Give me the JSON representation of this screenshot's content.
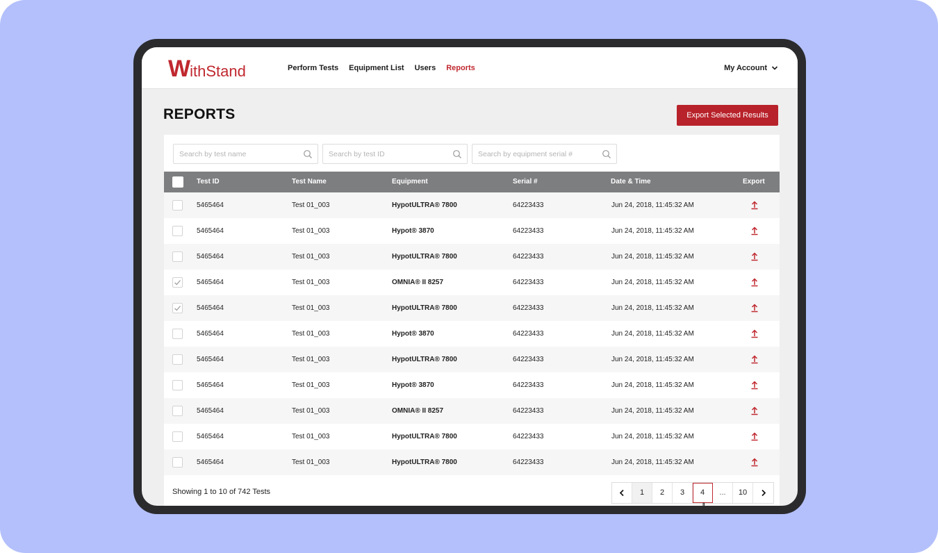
{
  "brand": {
    "logo_initial": "W",
    "logo_rest": "ithStand",
    "accent_color": "#b8222a"
  },
  "nav": {
    "items": [
      {
        "label": "Perform Tests",
        "active": false
      },
      {
        "label": "Equipment List",
        "active": false
      },
      {
        "label": "Users",
        "active": false
      },
      {
        "label": "Reports",
        "active": true
      }
    ],
    "account_label": "My Account"
  },
  "page": {
    "title": "REPORTS",
    "export_button": "Export Selected Results"
  },
  "search": {
    "test_name_placeholder": "Search by test name",
    "test_id_placeholder": "Search by test ID",
    "serial_placeholder": "Search by equipment serial #"
  },
  "table": {
    "columns": [
      "Test ID",
      "Test Name",
      "Equipment",
      "Serial #",
      "Date & Time",
      "Export"
    ],
    "rows": [
      {
        "checked": false,
        "test_id": "5465464",
        "test_name": "Test 01_003",
        "equipment": "HypotULTRA® 7800",
        "serial": "64223433",
        "datetime": "Jun 24, 2018,  11:45:32 AM"
      },
      {
        "checked": false,
        "test_id": "5465464",
        "test_name": "Test 01_003",
        "equipment": "Hypot® 3870",
        "serial": "64223433",
        "datetime": "Jun 24, 2018,  11:45:32 AM"
      },
      {
        "checked": false,
        "test_id": "5465464",
        "test_name": "Test 01_003",
        "equipment": "HypotULTRA® 7800",
        "serial": "64223433",
        "datetime": "Jun 24, 2018,  11:45:32 AM"
      },
      {
        "checked": true,
        "test_id": "5465464",
        "test_name": "Test 01_003",
        "equipment": "OMNIA® II 8257",
        "serial": "64223433",
        "datetime": "Jun 24, 2018,  11:45:32 AM"
      },
      {
        "checked": true,
        "test_id": "5465464",
        "test_name": "Test 01_003",
        "equipment": "HypotULTRA® 7800",
        "serial": "64223433",
        "datetime": "Jun 24, 2018,  11:45:32 AM"
      },
      {
        "checked": false,
        "test_id": "5465464",
        "test_name": "Test 01_003",
        "equipment": "Hypot® 3870",
        "serial": "64223433",
        "datetime": "Jun 24, 2018,  11:45:32 AM"
      },
      {
        "checked": false,
        "test_id": "5465464",
        "test_name": "Test 01_003",
        "equipment": "HypotULTRA® 7800",
        "serial": "64223433",
        "datetime": "Jun 24, 2018,  11:45:32 AM"
      },
      {
        "checked": false,
        "test_id": "5465464",
        "test_name": "Test 01_003",
        "equipment": "Hypot® 3870",
        "serial": "64223433",
        "datetime": "Jun 24, 2018,  11:45:32 AM"
      },
      {
        "checked": false,
        "test_id": "5465464",
        "test_name": "Test 01_003",
        "equipment": "OMNIA® II 8257",
        "serial": "64223433",
        "datetime": "Jun 24, 2018,  11:45:32 AM"
      },
      {
        "checked": false,
        "test_id": "5465464",
        "test_name": "Test 01_003",
        "equipment": "HypotULTRA® 7800",
        "serial": "64223433",
        "datetime": "Jun 24, 2018,  11:45:32 AM"
      },
      {
        "checked": false,
        "test_id": "5465464",
        "test_name": "Test 01_003",
        "equipment": "HypotULTRA® 7800",
        "serial": "64223433",
        "datetime": "Jun 24, 2018,  11:45:32 AM"
      }
    ]
  },
  "footer": {
    "showing_text": "Showing 1 to 10 of 742 Tests",
    "pages": [
      "1",
      "2",
      "3",
      "4",
      "...",
      "10"
    ],
    "current_page": "1",
    "hover_page": "4"
  },
  "icons": {
    "search": "search-icon",
    "export": "upload-arrow-icon",
    "prev": "chevron-left-icon",
    "next": "chevron-right-icon",
    "account": "chevron-down-icon"
  }
}
